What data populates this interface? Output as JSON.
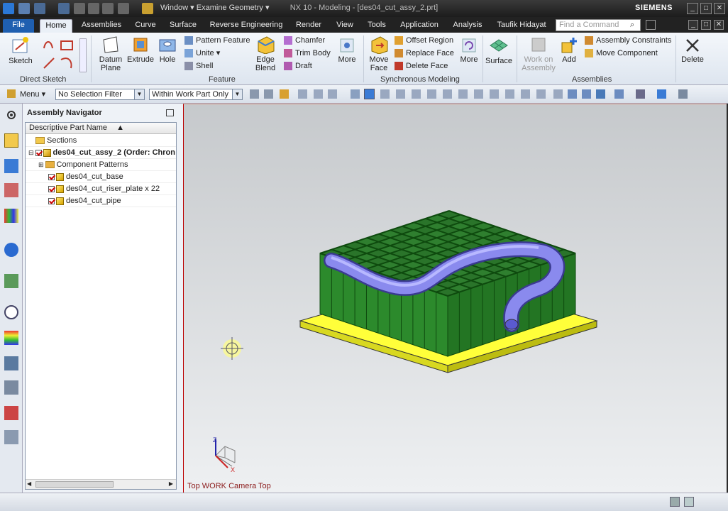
{
  "titlebar": {
    "window_menu": "Window ▾ Examine Geometry ▾",
    "title": "NX 10 - Modeling - [des04_cut_assy_2.prt]",
    "brand": "SIEMENS"
  },
  "tabs": [
    "File",
    "Home",
    "Assemblies",
    "Curve",
    "Surface",
    "Reverse Engineering",
    "Render",
    "View",
    "Tools",
    "Application",
    "Analysis",
    "Taufik Hidayat"
  ],
  "active_tab": "Home",
  "search": {
    "placeholder": "Find a Command"
  },
  "ribbon": {
    "sketch": "Sketch",
    "direct_sketch": "Direct Sketch",
    "datum_plane": "Datum Plane",
    "extrude": "Extrude",
    "hole": "Hole",
    "pattern_feature": "Pattern Feature",
    "unite": "Unite",
    "shell": "Shell",
    "edge_blend": "Edge Blend",
    "chamfer": "Chamfer",
    "trim_body": "Trim Body",
    "draft": "Draft",
    "more": "More",
    "feature": "Feature",
    "move_face": "Move Face",
    "offset_region": "Offset Region",
    "replace_face": "Replace Face",
    "delete_face": "Delete Face",
    "more2": "More",
    "synchronous_modeling": "Synchronous Modeling",
    "surface": "Surface",
    "work_on_assembly": "Work on Assembly",
    "add": "Add",
    "assembly_constraints": "Assembly Constraints",
    "move_component": "Move Component",
    "assemblies": "Assemblies",
    "delete": "Delete"
  },
  "toolbar": {
    "menu": "Menu ▾",
    "selection_filter": "No Selection Filter",
    "scope": "Within Work Part Only"
  },
  "navigator": {
    "title": "Assembly Navigator",
    "column": "Descriptive Part Name",
    "rows": [
      {
        "label": "Sections",
        "indent": 1,
        "type": "folder"
      },
      {
        "label": "des04_cut_assy_2 (Order: Chron",
        "indent": 0,
        "type": "assy",
        "bold": true
      },
      {
        "label": "Component Patterns",
        "indent": 2,
        "type": "pattern"
      },
      {
        "label": "des04_cut_base",
        "indent": 2,
        "type": "part"
      },
      {
        "label": "des04_cut_riser_plate x 22",
        "indent": 2,
        "type": "part"
      },
      {
        "label": "des04_cut_pipe",
        "indent": 2,
        "type": "part"
      }
    ]
  },
  "viewport": {
    "label": "Top WORK Camera Top"
  }
}
